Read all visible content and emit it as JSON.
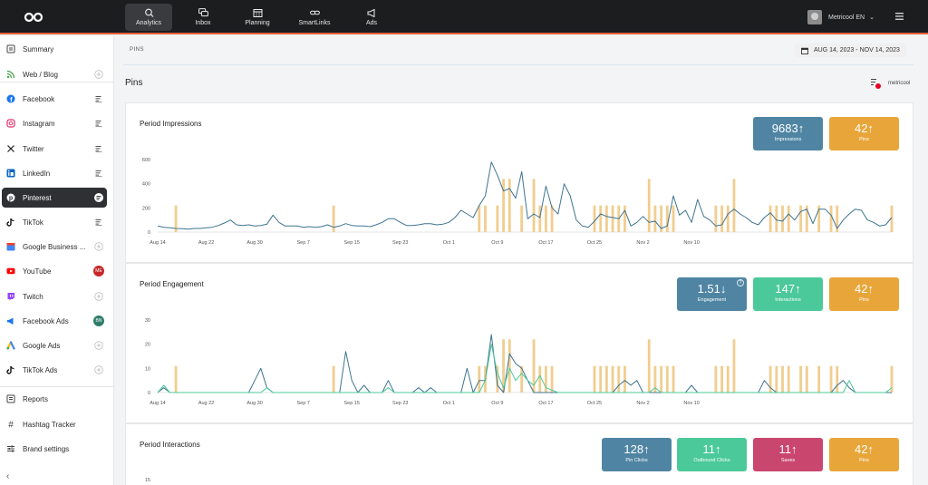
{
  "app": {
    "nav": [
      {
        "label": "Analytics",
        "icon": "analytics-icon",
        "active": true
      },
      {
        "label": "Inbox",
        "icon": "inbox-icon"
      },
      {
        "label": "Planning",
        "icon": "calendar-icon"
      },
      {
        "label": "SmartLinks",
        "icon": "link-icon"
      },
      {
        "label": "Ads",
        "icon": "megaphone-icon"
      }
    ],
    "user": "Metricool EN"
  },
  "sidebar": {
    "items": [
      {
        "label": "Summary",
        "icon": "summary-icon",
        "color": "#444444",
        "action": "none"
      },
      {
        "label": "Web / Blog",
        "icon": "rss-icon",
        "color": "#43a047",
        "action": "add"
      },
      {
        "label": "Facebook",
        "icon": "facebook-icon",
        "color": "#1877f2",
        "action": "report"
      },
      {
        "label": "Instagram",
        "icon": "instagram-icon",
        "color": "#e1306c",
        "action": "report"
      },
      {
        "label": "Twitter",
        "icon": "x-icon",
        "color": "#222222",
        "action": "report"
      },
      {
        "label": "LinkedIn",
        "icon": "linkedin-icon",
        "color": "#0a66c2",
        "action": "report"
      },
      {
        "label": "Pinterest",
        "icon": "pinterest-icon",
        "color": "#e60023",
        "action": "report",
        "active": true
      },
      {
        "label": "TikTok",
        "icon": "tiktok-icon",
        "color": "#111111",
        "action": "report"
      },
      {
        "label": "Google Business ...",
        "icon": "google-business-icon",
        "color": "#4285f4",
        "action": "add"
      },
      {
        "label": "YouTube",
        "icon": "youtube-icon",
        "color": "#ff0000",
        "action": "badge",
        "badge": "ME",
        "badge_color": "#c62828"
      },
      {
        "label": "Twitch",
        "icon": "twitch-icon",
        "color": "#9146ff",
        "action": "add"
      },
      {
        "label": "Facebook Ads",
        "icon": "facebook-ads-icon",
        "color": "#1877f2",
        "action": "badge",
        "badge": "BN",
        "badge_color": "#2e7d6b"
      },
      {
        "label": "Google Ads",
        "icon": "google-ads-icon",
        "color": "#34a853",
        "action": "add"
      },
      {
        "label": "TikTok Ads",
        "icon": "tiktok-ads-icon",
        "color": "#111111",
        "action": "add"
      }
    ],
    "footer": [
      {
        "label": "Reports",
        "icon": "reports-icon"
      },
      {
        "label": "Hashtag Tracker",
        "icon": "hashtag-icon"
      },
      {
        "label": "Brand settings",
        "icon": "settings-sliders-icon"
      }
    ]
  },
  "header": {
    "breadcrumb": "PINS",
    "date_range": "AUG 14, 2023 - NOV 14, 2023",
    "section_title": "Pins",
    "brand": "metricool"
  },
  "colors": {
    "impressions": "#4f85a3",
    "pins": "#e8a63a",
    "interactions": "#4bc99a",
    "saves": "#c9466f",
    "line": "#3f7490",
    "bar": "#f1cd8f"
  },
  "cards": {
    "impressions": {
      "title": "Period Impressions",
      "kpis": [
        {
          "value": "9683",
          "trend": "↑",
          "label": "Impressions",
          "color": "#4f85a3"
        },
        {
          "value": "42",
          "trend": "↑",
          "label": "Pins",
          "color": "#e8a63a"
        }
      ]
    },
    "engagement": {
      "title": "Period Engagement",
      "kpis": [
        {
          "value": "1.51",
          "trend": "↓",
          "label": "Engagement",
          "color": "#4f85a3",
          "help": "?"
        },
        {
          "value": "147",
          "trend": "↑",
          "label": "Interactions",
          "color": "#4bc99a"
        },
        {
          "value": "42",
          "trend": "↑",
          "label": "Pins",
          "color": "#e8a63a"
        }
      ]
    },
    "interactions": {
      "title": "Period Interactions",
      "kpis": [
        {
          "value": "128",
          "trend": "↑",
          "label": "Pin Clicks",
          "color": "#4f85a3"
        },
        {
          "value": "11",
          "trend": "↑",
          "label": "Outbound Clicks",
          "color": "#4bc99a"
        },
        {
          "value": "11",
          "trend": "↑",
          "label": "Saves",
          "color": "#c9466f"
        },
        {
          "value": "42",
          "trend": "↑",
          "label": "Pins",
          "color": "#e8a63a"
        }
      ]
    }
  },
  "chart_data": [
    {
      "type": "line",
      "title": "Period Impressions",
      "x_start": "2023-08-14",
      "x_labels": [
        "Aug 14",
        "Aug 22",
        "Aug 30",
        "Sep 7",
        "Sep 15",
        "Sep 23",
        "Oct 1",
        "Oct 9",
        "Oct 17",
        "Oct 25",
        "Nov 2",
        "Nov 10"
      ],
      "ylim": [
        0,
        600
      ],
      "yticks": [
        0,
        200,
        400,
        600
      ],
      "series": [
        {
          "name": "Impressions",
          "kind": "line",
          "color": "#3f7490",
          "values": [
            50,
            40,
            35,
            30,
            28,
            25,
            30,
            30,
            35,
            40,
            55,
            75,
            100,
            60,
            55,
            60,
            50,
            55,
            65,
            140,
            80,
            50,
            50,
            50,
            40,
            45,
            40,
            45,
            60,
            40,
            50,
            70,
            55,
            50,
            50,
            45,
            60,
            80,
            110,
            110,
            80,
            55,
            55,
            60,
            70,
            70,
            60,
            65,
            80,
            120,
            180,
            150,
            120,
            220,
            300,
            580,
            470,
            340,
            360,
            280,
            500,
            110,
            150,
            120,
            380,
            200,
            150,
            400,
            300,
            100,
            50,
            40,
            90,
            150,
            130,
            120,
            110,
            180,
            50,
            80,
            130,
            80,
            90,
            30,
            50,
            300,
            140,
            180,
            80,
            270,
            130,
            100,
            50,
            60,
            150,
            190,
            150,
            120,
            80,
            60,
            120,
            160,
            100,
            90,
            150,
            100,
            170,
            190,
            70,
            190,
            190,
            140,
            30,
            100,
            150,
            190,
            180,
            100,
            80,
            50,
            60,
            120
          ]
        },
        {
          "name": "Pins",
          "kind": "bar",
          "color": "#f1cd8f",
          "values": [
            0,
            0,
            0,
            220,
            0,
            0,
            0,
            0,
            0,
            0,
            0,
            0,
            0,
            0,
            0,
            0,
            0,
            0,
            0,
            0,
            0,
            0,
            0,
            0,
            0,
            0,
            0,
            0,
            0,
            220,
            0,
            0,
            0,
            0,
            0,
            0,
            0,
            0,
            0,
            0,
            0,
            0,
            0,
            0,
            0,
            0,
            0,
            0,
            0,
            0,
            0,
            0,
            0,
            220,
            220,
            0,
            220,
            440,
            440,
            0,
            220,
            0,
            440,
            220,
            220,
            220,
            0,
            0,
            0,
            0,
            0,
            0,
            220,
            220,
            220,
            220,
            220,
            220,
            0,
            0,
            0,
            440,
            220,
            220,
            220,
            220,
            0,
            0,
            0,
            0,
            0,
            0,
            220,
            220,
            220,
            440,
            0,
            0,
            0,
            0,
            0,
            220,
            220,
            220,
            220,
            0,
            220,
            220,
            0,
            220,
            0,
            220,
            220,
            0,
            0,
            0,
            0,
            0,
            0,
            0,
            0,
            220
          ]
        }
      ]
    },
    {
      "type": "line",
      "title": "Period Engagement",
      "x_start": "2023-08-14",
      "x_labels": [
        "Aug 14",
        "Aug 22",
        "Aug 30",
        "Sep 7",
        "Sep 15",
        "Sep 23",
        "Oct 1",
        "Oct 9",
        "Oct 17",
        "Oct 25",
        "Nov 2",
        "Nov 10"
      ],
      "ylim": [
        0,
        30
      ],
      "yticks": [
        0,
        10,
        20,
        30
      ],
      "series": [
        {
          "name": "Engagement",
          "kind": "line",
          "color": "#3f7490",
          "values": [
            0,
            2,
            0,
            0,
            0,
            0,
            0,
            0,
            0,
            0,
            0,
            0,
            0,
            0,
            0,
            0,
            5,
            10,
            2,
            0,
            0,
            0,
            0,
            0,
            0,
            0,
            0,
            0,
            0,
            0,
            0,
            17,
            5,
            0,
            3,
            0,
            0,
            0,
            5,
            0,
            0,
            0,
            0,
            2,
            0,
            2,
            0,
            0,
            0,
            0,
            0,
            10,
            0,
            5,
            5,
            24,
            3,
            0,
            16,
            12,
            10,
            5,
            0,
            0,
            0,
            0,
            0,
            0,
            0,
            0,
            0,
            0,
            0,
            0,
            0,
            0,
            3,
            5,
            3,
            5,
            0,
            0,
            0,
            0,
            0,
            0,
            0,
            0,
            3,
            0,
            0,
            0,
            0,
            0,
            0,
            0,
            0,
            0,
            0,
            0,
            5,
            2,
            0,
            0,
            0,
            0,
            0,
            0,
            0,
            0,
            0,
            0,
            3,
            5,
            2,
            0,
            0,
            0,
            0,
            0,
            0,
            0
          ]
        },
        {
          "name": "Interactions",
          "kind": "line",
          "color": "#4bc99a",
          "values": [
            0,
            3,
            0,
            0,
            0,
            0,
            0,
            0,
            0,
            0,
            0,
            0,
            0,
            0,
            0,
            0,
            0,
            0,
            2,
            0,
            0,
            0,
            0,
            0,
            0,
            0,
            0,
            0,
            0,
            0,
            0,
            0,
            0,
            0,
            0,
            0,
            0,
            0,
            2,
            0,
            0,
            0,
            0,
            0,
            0,
            0,
            0,
            0,
            0,
            0,
            0,
            0,
            0,
            0,
            5,
            20,
            8,
            2,
            10,
            5,
            8,
            5,
            3,
            7,
            2,
            1,
            0,
            0,
            0,
            0,
            0,
            0,
            0,
            0,
            0,
            0,
            0,
            0,
            0,
            0,
            0,
            0,
            2,
            0,
            0,
            0,
            0,
            0,
            0,
            0,
            0,
            0,
            0,
            0,
            0,
            0,
            0,
            0,
            0,
            0,
            0,
            0,
            0,
            0,
            0,
            0,
            0,
            0,
            0,
            0,
            0,
            0,
            0,
            0,
            5,
            0,
            0,
            0,
            0,
            0,
            0,
            2
          ]
        },
        {
          "name": "Pins",
          "kind": "bar",
          "color": "#f1cd8f",
          "values": [
            0,
            0,
            0,
            11,
            0,
            0,
            0,
            0,
            0,
            0,
            0,
            0,
            0,
            0,
            0,
            0,
            0,
            0,
            0,
            0,
            0,
            0,
            0,
            0,
            0,
            0,
            0,
            0,
            0,
            11,
            0,
            0,
            0,
            0,
            0,
            0,
            0,
            0,
            0,
            0,
            0,
            0,
            0,
            0,
            0,
            0,
            0,
            0,
            0,
            0,
            0,
            0,
            0,
            11,
            11,
            0,
            11,
            22,
            22,
            0,
            11,
            0,
            22,
            11,
            11,
            11,
            0,
            0,
            0,
            0,
            0,
            0,
            11,
            11,
            11,
            11,
            11,
            11,
            0,
            0,
            0,
            22,
            11,
            11,
            11,
            11,
            0,
            0,
            0,
            0,
            0,
            0,
            11,
            11,
            11,
            22,
            0,
            0,
            0,
            0,
            0,
            11,
            11,
            11,
            11,
            0,
            11,
            11,
            0,
            11,
            0,
            11,
            11,
            0,
            0,
            0,
            0,
            0,
            0,
            0,
            0,
            11
          ]
        }
      ]
    },
    {
      "type": "line",
      "title": "Period Interactions",
      "yticks": [
        15
      ]
    }
  ]
}
